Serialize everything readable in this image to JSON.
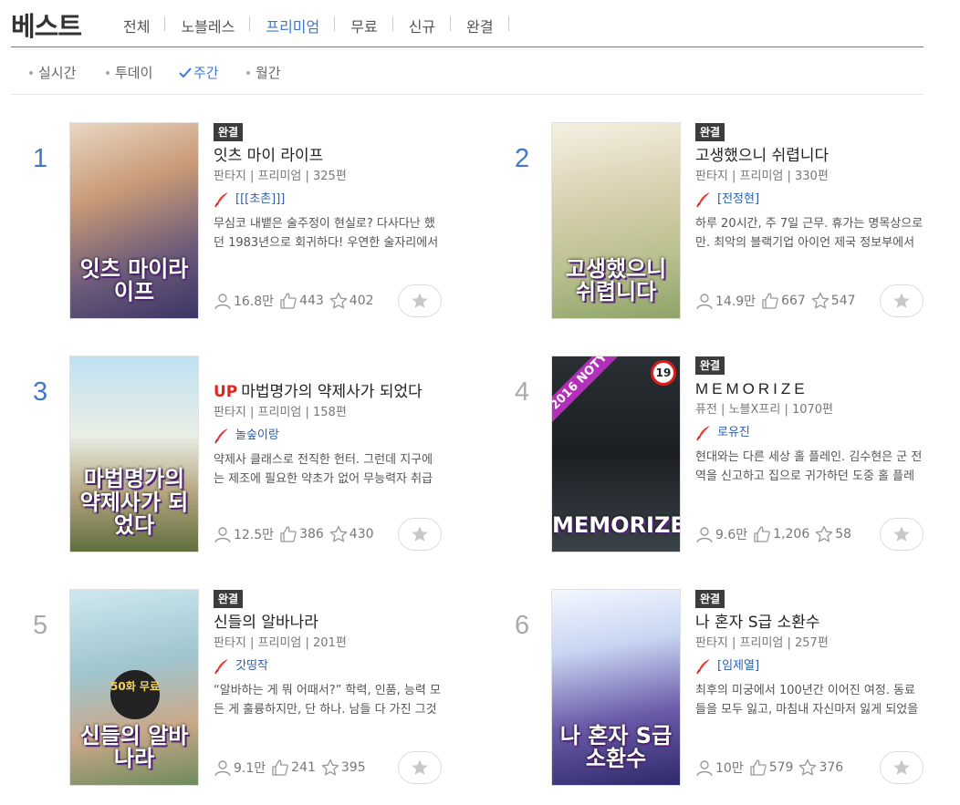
{
  "header": {
    "title": "베스트",
    "tabs": [
      "전체",
      "노블레스",
      "프리미엄",
      "무료",
      "신규",
      "완결"
    ],
    "active_tab": "프리미엄"
  },
  "subtabs": {
    "items": [
      "실시간",
      "투데이",
      "주간",
      "월간"
    ],
    "active": "주간"
  },
  "colors": {
    "accent": "#3f78d0",
    "badge": "#3c3c3c",
    "up": "#e0251e"
  },
  "icons": {
    "views": "person-icon",
    "likes": "thumbs-up-icon",
    "stars": "star-outline-icon",
    "author": "feather-pen-icon",
    "favorite": "star-filled-icon"
  },
  "books": [
    {
      "rank": "1",
      "badge": "완결",
      "title": "잇츠 마이 라이프",
      "up": "",
      "meta": "판타지 | 프리미엄 | 325편",
      "author": "[[[초촌]]]",
      "desc": "무심코 내뱉은 술주정이 현실로? 다사다난 했던 1983년으로 회귀하다! 우연한 술자리에서 시작된 인생 역전",
      "views": "16.8만",
      "likes": "443",
      "stars": "402",
      "cover_text": "잇츠 마이라이프"
    },
    {
      "rank": "2",
      "badge": "완결",
      "title": "고생했으니 쉬렵니다",
      "up": "",
      "meta": "판타지 | 프리미엄 | 330편",
      "author": "[전정현]",
      "desc": "하루 20시간, 주 7일 근무. 휴가는 명목상으로만. 최악의 블랙기업 아이언 제국 정보부에서",
      "views": "14.9만",
      "likes": "667",
      "stars": "547",
      "cover_text": "고생했으니 쉬렵니다"
    },
    {
      "rank": "3",
      "badge": "",
      "title": "마법명가의 약제사가 되었다",
      "up": "UP",
      "meta": "판타지 | 프리미엄 | 158편",
      "author": "놀숲이랑",
      "desc": "약제사 클래스로 전직한 헌터. 그런데 지구에는 제조에 필요한 약초가 없어 무능력자 취급을 받는다",
      "views": "12.5만",
      "likes": "386",
      "stars": "430",
      "cover_text": "마법명가의 약제사가 되었다"
    },
    {
      "rank": "4",
      "badge": "완결",
      "title": "MEMORIZE",
      "up": "",
      "meta": "퓨전 | 노블X프리 | 1070편",
      "author": "로유진",
      "desc": "현대와는 다른 세상 홀 플레인. 김수현은 군 전역을 신고하고 집으로 귀가하던 도중 홀 플레인에",
      "views": "9.6만",
      "likes": "1,206",
      "stars": "58",
      "cover_text": "MEMORIZE",
      "age": "19",
      "ribbon": "2016 NOTY"
    },
    {
      "rank": "5",
      "badge": "완결",
      "title": "신들의 알바나라",
      "up": "",
      "meta": "판타지 | 프리미엄 | 201편",
      "author": "갓띵작",
      "desc": "“알바하는 게 뭐 어때서?” 학력, 인품, 능력 모든 게 훌륭하지만, 단 하나. 남들 다 가진 그것이",
      "views": "9.1만",
      "likes": "241",
      "stars": "395",
      "cover_text": "신들의 알바나라",
      "free": "50화 무료"
    },
    {
      "rank": "6",
      "badge": "완결",
      "title": "나 혼자 S급 소환수",
      "up": "",
      "meta": "판타지 | 프리미엄 | 257편",
      "author": "[임제열]",
      "desc": "최후의 미궁에서 100년간 이어진 여정. 동료들을 모두 잃고, 마침내 자신마저 잃게 되었을 때",
      "views": "10만",
      "likes": "579",
      "stars": "376",
      "cover_text": "나 혼자 S급 소환수"
    }
  ]
}
